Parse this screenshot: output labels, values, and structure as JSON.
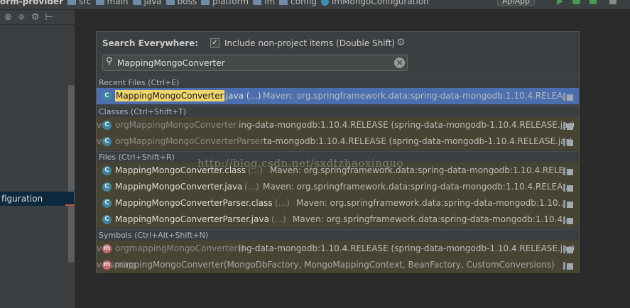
{
  "navbar": {
    "crumbs": [
      "orm-provider",
      "src",
      "main",
      "java",
      "boss",
      "platform",
      "im",
      "config",
      "ImMongoConfiguration"
    ],
    "run_config": "ApiApp"
  },
  "left_panel": {
    "selected_item": "figuration"
  },
  "popup": {
    "title": "Search Everywhere:",
    "include_label": "Include non-project items (Double Shift)",
    "include_checked": true,
    "query": "MappingMongoConverter",
    "groups": {
      "recent": "Recent Files (Ctrl+E)",
      "classes": "Classes (Ctrl+Shift+T)",
      "files": "Files (Ctrl+Shift+R)",
      "symbols": "Symbols (Ctrl+Alt+Shift+N)"
    },
    "recent": [
      {
        "name": "MappingMongoConverter",
        "ext": ".java (...)",
        "loc": "Maven: org.springframework.data:spring-data-mongodb:1.10.4.RELEA..."
      }
    ],
    "classes": [
      {
        "prefix": "ve",
        "ghost": "orgMappingMongoConverter",
        "loc": "ing-data-mongodb:1.10.4.RELEASE (spring-data-mongodb-1.10.4.RELEASE.jar)"
      },
      {
        "prefix": "ve",
        "ghost": "orgMappingMongoConverterParser",
        "loc": "ta-mongodb:1.10.4.RELEASE (spring-data-mongodb-1.10.4.RELEASE.jar)"
      }
    ],
    "files": [
      {
        "name": "MappingMongoConverter.class",
        "ext": "(...)",
        "loc": "Maven: org.springframework.data:spring-data-mongodb:1.10.4.RELE..."
      },
      {
        "name": "MappingMongoConverter.java",
        "ext": "(...)",
        "loc": "Maven: org.springframework.data:spring-data-mongodb:1.10.4.RELEA..."
      },
      {
        "name": "MappingMongoConverterParser.class",
        "ext": "(...)",
        "loc": "Maven: org.springframework.data:spring-data-mongodb:1.10...."
      },
      {
        "name": "MappingMongoConverterParser.java",
        "ext": "(...)",
        "loc": "Maven: org.springframework.data:spring-data-mongodb:1.10.4...."
      }
    ],
    "symbols": [
      {
        "prefix": "ve",
        "ghost": "orgmappingMongoConverter()",
        "loc": "ing-data-mongodb:1.10.4.RELEASE (spring-data-mongodb-1.10.4.RELEASE.jar)"
      },
      {
        "prefix": "ve.spring",
        "ghost": "mappingMongoConverter(MongoDbFactory, MongoMappingContext, BeanFactory, CustomConversions)",
        "loc": ""
      }
    ]
  },
  "watermark": "http://blog.csdn.net/sxdtzhaoxinguo"
}
